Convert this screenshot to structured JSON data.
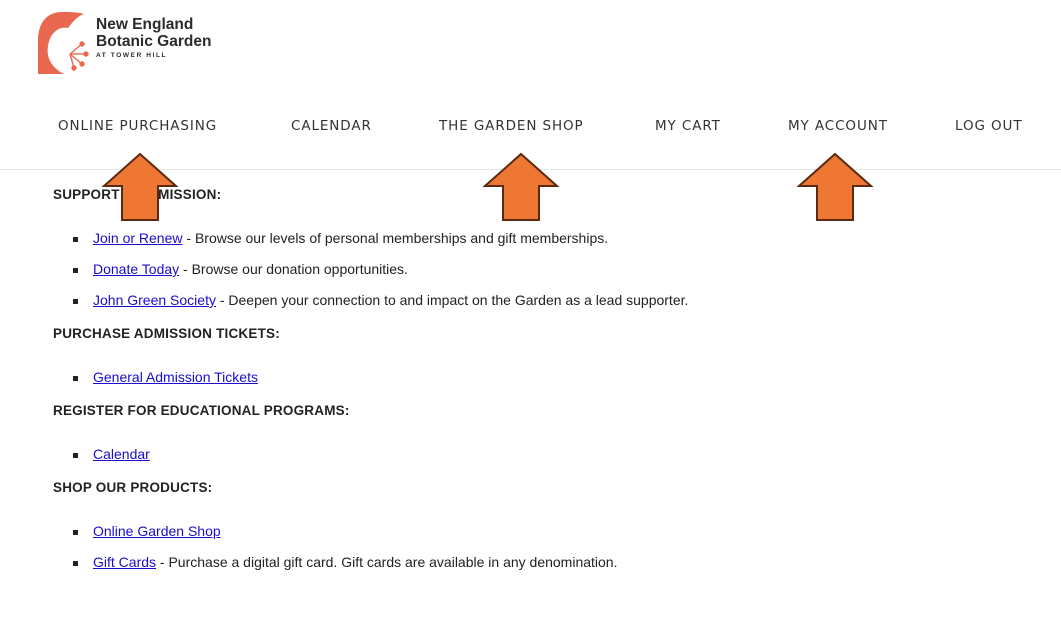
{
  "brand": {
    "line1": "New England",
    "line2": "Botanic Garden",
    "tagline": "AT TOWER HILL",
    "color": "#e8694f"
  },
  "nav": {
    "online_purchasing": "ONLINE PURCHASING",
    "calendar": "CALENDAR",
    "garden_shop": "THE GARDEN SHOP",
    "my_cart": "MY CART",
    "my_account": "MY ACCOUNT",
    "log_out": "LOG OUT"
  },
  "sections": {
    "support": {
      "heading": "SUPPORT OUR MISSION:",
      "items": [
        {
          "link": "Join or Renew",
          "text": " - Browse our levels of personal memberships and gift memberships."
        },
        {
          "link": "Donate Today",
          "text": " - Browse our donation opportunities."
        },
        {
          "link": "John Green Society",
          "text": " - Deepen your connection to and impact on the Garden as a lead supporter."
        }
      ]
    },
    "admission": {
      "heading": "PURCHASE ADMISSION TICKETS:",
      "items": [
        {
          "link": "General Admission Tickets",
          "text": ""
        }
      ]
    },
    "education": {
      "heading": "REGISTER FOR EDUCATIONAL PROGRAMS:",
      "items": [
        {
          "link": "Calendar",
          "text": ""
        }
      ]
    },
    "shop": {
      "heading": "SHOP OUR PRODUCTS:",
      "items": [
        {
          "link": "Online Garden Shop",
          "text": ""
        },
        {
          "link": "Gift Cards",
          "text": " - Purchase a digital gift card. Gift cards are available in any denomination."
        }
      ]
    }
  },
  "annotations": {
    "arrow_color": "#ee7733",
    "arrow_outline": "#5a2a10",
    "icon": "up-arrow-icon"
  }
}
